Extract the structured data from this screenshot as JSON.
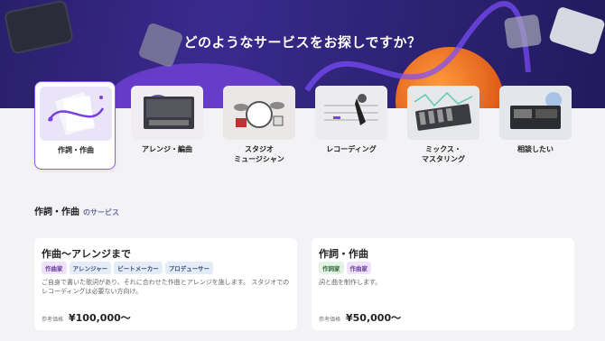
{
  "hero": {
    "title": "どのようなサービスをお探しですか？"
  },
  "categories": [
    {
      "label": "作詞・作曲",
      "active": true
    },
    {
      "label": "アレンジ・編曲",
      "active": false
    },
    {
      "label": "スタジオ\nミュージシャン",
      "active": false
    },
    {
      "label": "レコーディング",
      "active": false
    },
    {
      "label": "ミックス・\nマスタリング",
      "active": false
    },
    {
      "label": "相談したい",
      "active": false
    }
  ],
  "section": {
    "title": "作詞・作曲",
    "subtitle": "のサービス"
  },
  "cards": [
    {
      "title": "作曲〜アレンジまで",
      "tags": [
        "作曲家",
        "アレンジャー",
        "ビートメーカー",
        "プロデューサー"
      ],
      "description": "ご自身で書いた歌詞があり、それに合わせた作曲とアレンジを施します。 スタジオでのレコーディングは必要ない方向け。",
      "price_label": "参考価格",
      "price": "¥100,000〜"
    },
    {
      "title": "作詞・作曲",
      "tags": [
        "作詞家",
        "作曲家"
      ],
      "description": "詞と曲を制作します。",
      "price_label": "参考価格",
      "price": "¥50,000〜"
    }
  ],
  "colors": {
    "accent": "#8a5cf0",
    "hero_bg": "#2f2478"
  }
}
